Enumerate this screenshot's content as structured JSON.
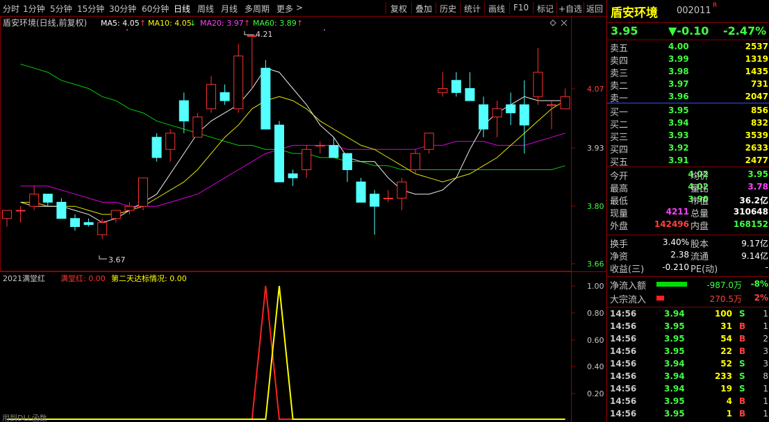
{
  "toolbar": {
    "items": [
      "分时",
      "1分钟",
      "5分钟",
      "15分钟",
      "30分钟",
      "60分钟",
      "日线",
      "周线",
      "月线",
      "多周期",
      "更多"
    ],
    "active": "日线",
    "more_arrow": ">",
    "actions": [
      "复权",
      "叠加",
      "历史",
      "统计",
      "画线",
      "F10",
      "标记",
      "+自选",
      "返回"
    ]
  },
  "main_chart": {
    "title": "盾安环境(日线,前复权)",
    "ma5_label": "MA5: 4.05",
    "ma10_label": "MA10: 4.05",
    "ma20_label": "MA20: 3.97",
    "ma60_label": "MA60: 3.89",
    "ma5_arrow": "↑",
    "ma10_arrow": "↓",
    "ma20_arrow": "↑",
    "ma60_arrow": "↑",
    "y_ticks": [
      "4.07",
      "3.93",
      "3.80",
      "3.66"
    ],
    "high_marker": "4.21",
    "low_marker": "3.67",
    "colors": {
      "up": "#ff3232",
      "down": "#54ffff",
      "ma5": "#ffffff",
      "ma10": "#ffff00",
      "ma20": "#ff00ff",
      "ma60": "#00ff00"
    }
  },
  "chart_data": {
    "type": "candlestick",
    "y_range": [
      3.64,
      4.25
    ],
    "candles": [
      {
        "o": 3.76,
        "h": 3.78,
        "l": 3.74,
        "c": 3.78
      },
      {
        "o": 3.78,
        "h": 3.79,
        "l": 3.75,
        "c": 3.78
      },
      {
        "o": 3.79,
        "h": 3.84,
        "l": 3.78,
        "c": 3.82
      },
      {
        "o": 3.82,
        "h": 3.82,
        "l": 3.79,
        "c": 3.8
      },
      {
        "o": 3.8,
        "h": 3.81,
        "l": 3.76,
        "c": 3.76
      },
      {
        "o": 3.76,
        "h": 3.77,
        "l": 3.73,
        "c": 3.74
      },
      {
        "o": 3.75,
        "h": 3.76,
        "l": 3.74,
        "c": 3.745
      },
      {
        "o": 3.72,
        "h": 3.76,
        "l": 3.71,
        "c": 3.75
      },
      {
        "o": 3.76,
        "h": 3.78,
        "l": 3.75,
        "c": 3.78
      },
      {
        "o": 3.78,
        "h": 3.8,
        "l": 3.77,
        "c": 3.79
      },
      {
        "o": 3.79,
        "h": 3.86,
        "l": 3.78,
        "c": 3.86
      },
      {
        "o": 3.96,
        "h": 3.97,
        "l": 3.9,
        "c": 3.91
      },
      {
        "o": 3.93,
        "h": 3.98,
        "l": 3.9,
        "c": 3.97
      },
      {
        "o": 4.05,
        "h": 4.07,
        "l": 3.97,
        "c": 4.0
      },
      {
        "o": 3.96,
        "h": 4.02,
        "l": 3.96,
        "c": 4.01
      },
      {
        "o": 4.03,
        "h": 4.11,
        "l": 4.02,
        "c": 4.09
      },
      {
        "o": 4.07,
        "h": 4.09,
        "l": 4.04,
        "c": 4.05
      },
      {
        "o": 4.03,
        "h": 4.19,
        "l": 4.02,
        "c": 4.16
      },
      {
        "o": 4.21,
        "h": 4.21,
        "l": 4.08,
        "c": 4.21
      },
      {
        "o": 4.13,
        "h": 4.15,
        "l": 3.98,
        "c": 3.98
      },
      {
        "o": 3.99,
        "h": 4.0,
        "l": 3.85,
        "c": 3.85
      },
      {
        "o": 3.87,
        "h": 3.88,
        "l": 3.84,
        "c": 3.86
      },
      {
        "o": 3.88,
        "h": 3.94,
        "l": 3.86,
        "c": 3.93
      },
      {
        "o": 3.94,
        "h": 3.95,
        "l": 3.92,
        "c": 3.94
      },
      {
        "o": 3.94,
        "h": 3.96,
        "l": 3.91,
        "c": 3.91
      },
      {
        "o": 3.92,
        "h": 3.92,
        "l": 3.85,
        "c": 3.88
      },
      {
        "o": 3.85,
        "h": 3.86,
        "l": 3.8,
        "c": 3.8
      },
      {
        "o": 3.82,
        "h": 3.83,
        "l": 3.72,
        "c": 3.79
      },
      {
        "o": 3.81,
        "h": 3.83,
        "l": 3.8,
        "c": 3.81
      },
      {
        "o": 3.81,
        "h": 3.86,
        "l": 3.78,
        "c": 3.85
      },
      {
        "o": 3.88,
        "h": 3.93,
        "l": 3.87,
        "c": 3.92
      },
      {
        "o": 3.93,
        "h": 3.97,
        "l": 3.92,
        "c": 3.97
      },
      {
        "o": 4.07,
        "h": 4.12,
        "l": 4.06,
        "c": 4.08
      },
      {
        "o": 4.1,
        "h": 4.12,
        "l": 4.06,
        "c": 4.07
      },
      {
        "o": 4.08,
        "h": 4.12,
        "l": 4.05,
        "c": 4.05
      },
      {
        "o": 4.04,
        "h": 4.06,
        "l": 3.96,
        "c": 3.98
      },
      {
        "o": 4.01,
        "h": 4.05,
        "l": 3.96,
        "c": 4.03
      },
      {
        "o": 4.04,
        "h": 4.07,
        "l": 3.99,
        "c": 4.02
      },
      {
        "o": 4.04,
        "h": 4.1,
        "l": 3.92,
        "c": 3.99
      },
      {
        "o": 4.06,
        "h": 4.18,
        "l": 4.04,
        "c": 4.12
      },
      {
        "o": 4.04,
        "h": 4.05,
        "l": 3.98,
        "c": 4.04
      },
      {
        "o": 4.03,
        "h": 4.08,
        "l": 4.03,
        "c": 4.06
      }
    ],
    "ma5": [
      3.8,
      3.79,
      3.79,
      3.79,
      3.78,
      3.77,
      3.75,
      3.76,
      3.78,
      3.8,
      3.82,
      3.87,
      3.92,
      3.97,
      4.0,
      4.02,
      4.04,
      4.08,
      4.13,
      4.12,
      4.08,
      4.04,
      3.99,
      3.96,
      3.91,
      3.9,
      3.9,
      3.86,
      3.83,
      3.82,
      3.82,
      3.83,
      3.86,
      3.93,
      3.99,
      4.02,
      4.04,
      4.06,
      4.05,
      4.05,
      4.05
    ],
    "ma10": [
      3.8,
      3.8,
      3.79,
      3.79,
      3.79,
      3.78,
      3.77,
      3.77,
      3.78,
      3.79,
      3.81,
      3.83,
      3.85,
      3.88,
      3.92,
      3.96,
      3.99,
      4.03,
      4.05,
      4.06,
      4.05,
      4.03,
      4.0,
      3.98,
      3.96,
      3.94,
      3.93,
      3.91,
      3.89,
      3.87,
      3.86,
      3.85,
      3.86,
      3.87,
      3.89,
      3.91,
      3.94,
      3.97,
      4.0,
      4.03,
      4.05
    ],
    "ma20": [
      3.84,
      3.84,
      3.84,
      3.83,
      3.82,
      3.81,
      3.8,
      3.8,
      3.79,
      3.79,
      3.79,
      3.8,
      3.81,
      3.82,
      3.84,
      3.86,
      3.88,
      3.9,
      3.92,
      3.93,
      3.94,
      3.94,
      3.94,
      3.94,
      3.93,
      3.93,
      3.93,
      3.93,
      3.93,
      3.93,
      3.94,
      3.94,
      3.95,
      3.95,
      3.95,
      3.94,
      3.94,
      3.94,
      3.95,
      3.96,
      3.97
    ],
    "ma60": [
      4.14,
      4.13,
      4.12,
      4.1,
      4.09,
      4.08,
      4.06,
      4.05,
      4.03,
      4.02,
      4.0,
      3.99,
      3.98,
      3.97,
      3.96,
      3.95,
      3.94,
      3.94,
      3.93,
      3.93,
      3.92,
      3.92,
      3.91,
      3.91,
      3.9,
      3.9,
      3.89,
      3.89,
      3.88,
      3.88,
      3.88,
      3.88,
      3.88,
      3.88,
      3.88,
      3.88,
      3.88,
      3.88,
      3.88,
      3.88,
      3.89
    ]
  },
  "sub_chart": {
    "title": "2021满堂红",
    "line1_label": "满堂红: 0.00",
    "line2_label": "第二天达标情况: 0.00",
    "y_ticks": [
      "1.00",
      "0.80",
      "0.60",
      "0.40",
      "0.20"
    ],
    "footer": "用到DLL函数",
    "spike_red_index": 19,
    "spike_yellow_index": 20
  },
  "quote": {
    "name": "盾安环境",
    "code": "002011",
    "r_badge": "R",
    "price": "3.95",
    "change": "▼-0.10",
    "change_pct": "-2.47%",
    "asks": [
      {
        "label": "卖五",
        "price": "4.00",
        "vol": "2537"
      },
      {
        "label": "卖四",
        "price": "3.99",
        "vol": "1319"
      },
      {
        "label": "卖三",
        "price": "3.98",
        "vol": "1435"
      },
      {
        "label": "卖二",
        "price": "3.97",
        "vol": "731"
      },
      {
        "label": "卖一",
        "price": "3.96",
        "vol": "2047"
      }
    ],
    "bids": [
      {
        "label": "买一",
        "price": "3.95",
        "vol": "856"
      },
      {
        "label": "买二",
        "price": "3.94",
        "vol": "832"
      },
      {
        "label": "买三",
        "price": "3.93",
        "vol": "3539"
      },
      {
        "label": "买四",
        "price": "3.92",
        "vol": "2633"
      },
      {
        "label": "买五",
        "price": "3.91",
        "vol": "2477"
      }
    ],
    "stats": [
      {
        "l1": "今开",
        "v1": "4.02",
        "l2": "均价",
        "v2": "3.95"
      },
      {
        "l1": "最高",
        "v1": "4.02",
        "l2": "量比",
        "v2": "3.78"
      },
      {
        "l1": "最低",
        "v1": "3.90",
        "l2": "市值",
        "v2": "36.2亿"
      },
      {
        "l1": "现量",
        "v1": "4211",
        "l2": "总量",
        "v2": "310648"
      },
      {
        "l1": "外盘",
        "v1": "142496",
        "l2": "内盘",
        "v2": "168152"
      }
    ],
    "stats2": [
      {
        "l1": "换手",
        "v1": "3.40%",
        "l2": "股本",
        "v2": "9.17亿"
      },
      {
        "l1": "净资",
        "v1": "2.38",
        "l2": "流通",
        "v2": "9.14亿"
      },
      {
        "l1": "收益(三)",
        "v1": "-0.210",
        "l2": "PE(动)",
        "v2": "-"
      }
    ],
    "flow": [
      {
        "label": "净流入额",
        "value": "-987.0万",
        "pct": "-8%",
        "bar_color": "#00dd00",
        "bar_fraction": 0.8
      },
      {
        "label": "大宗流入",
        "value": "270.5万",
        "pct": "2%",
        "bar_color": "#ff2020",
        "bar_fraction": 0.2
      }
    ],
    "ticks": [
      {
        "time": "14:56",
        "price": "3.94",
        "vol": "100",
        "side": "S",
        "n": "1"
      },
      {
        "time": "14:56",
        "price": "3.95",
        "vol": "31",
        "side": "B",
        "n": "1"
      },
      {
        "time": "14:56",
        "price": "3.95",
        "vol": "54",
        "side": "B",
        "n": "2"
      },
      {
        "time": "14:56",
        "price": "3.95",
        "vol": "22",
        "side": "B",
        "n": "3"
      },
      {
        "time": "14:56",
        "price": "3.94",
        "vol": "52",
        "side": "S",
        "n": "3"
      },
      {
        "time": "14:56",
        "price": "3.94",
        "vol": "233",
        "side": "S",
        "n": "8"
      },
      {
        "time": "14:56",
        "price": "3.94",
        "vol": "19",
        "side": "S",
        "n": "1"
      },
      {
        "time": "14:56",
        "price": "3.95",
        "vol": "4",
        "side": "B",
        "n": "1"
      },
      {
        "time": "14:56",
        "price": "3.95",
        "vol": "1",
        "side": "B",
        "n": "1"
      }
    ]
  }
}
